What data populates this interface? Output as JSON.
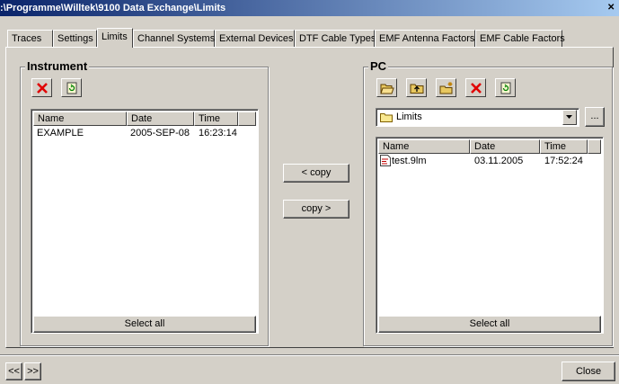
{
  "window": {
    "title": ":\\Programme\\Willtek\\9100 Data Exchange\\Limits"
  },
  "tabs": [
    {
      "label": "Traces"
    },
    {
      "label": "Settings"
    },
    {
      "label": "Limits"
    },
    {
      "label": "Channel Systems"
    },
    {
      "label": "External Devices"
    },
    {
      "label": "DTF Cable Types"
    },
    {
      "label": "EMF Antenna Factors"
    },
    {
      "label": "EMF Cable Factors"
    }
  ],
  "active_tab": "Limits",
  "instrument": {
    "label": "Instrument",
    "columns": [
      "Name",
      "Date",
      "Time"
    ],
    "rows": [
      {
        "name": "EXAMPLE",
        "date": "2005-SEP-08",
        "time": "16:23:14"
      }
    ],
    "select_all": "Select all"
  },
  "transfer": {
    "copy_to_instrument": "< copy",
    "copy_to_pc": "copy >"
  },
  "pc": {
    "label": "PC",
    "folder": "Limits",
    "browse": "...",
    "columns": [
      "Name",
      "Date",
      "Time"
    ],
    "rows": [
      {
        "name": "test.9lm",
        "date": "03.11.2005",
        "time": "17:52:24"
      }
    ],
    "select_all": "Select all"
  },
  "footer": {
    "prev": "<<",
    "next": ">>",
    "close": "Close"
  },
  "colors": {
    "title_start": "#0a246a",
    "title_end": "#a6caf0",
    "face": "#d4d0c8",
    "delete_red": "#e00000"
  }
}
